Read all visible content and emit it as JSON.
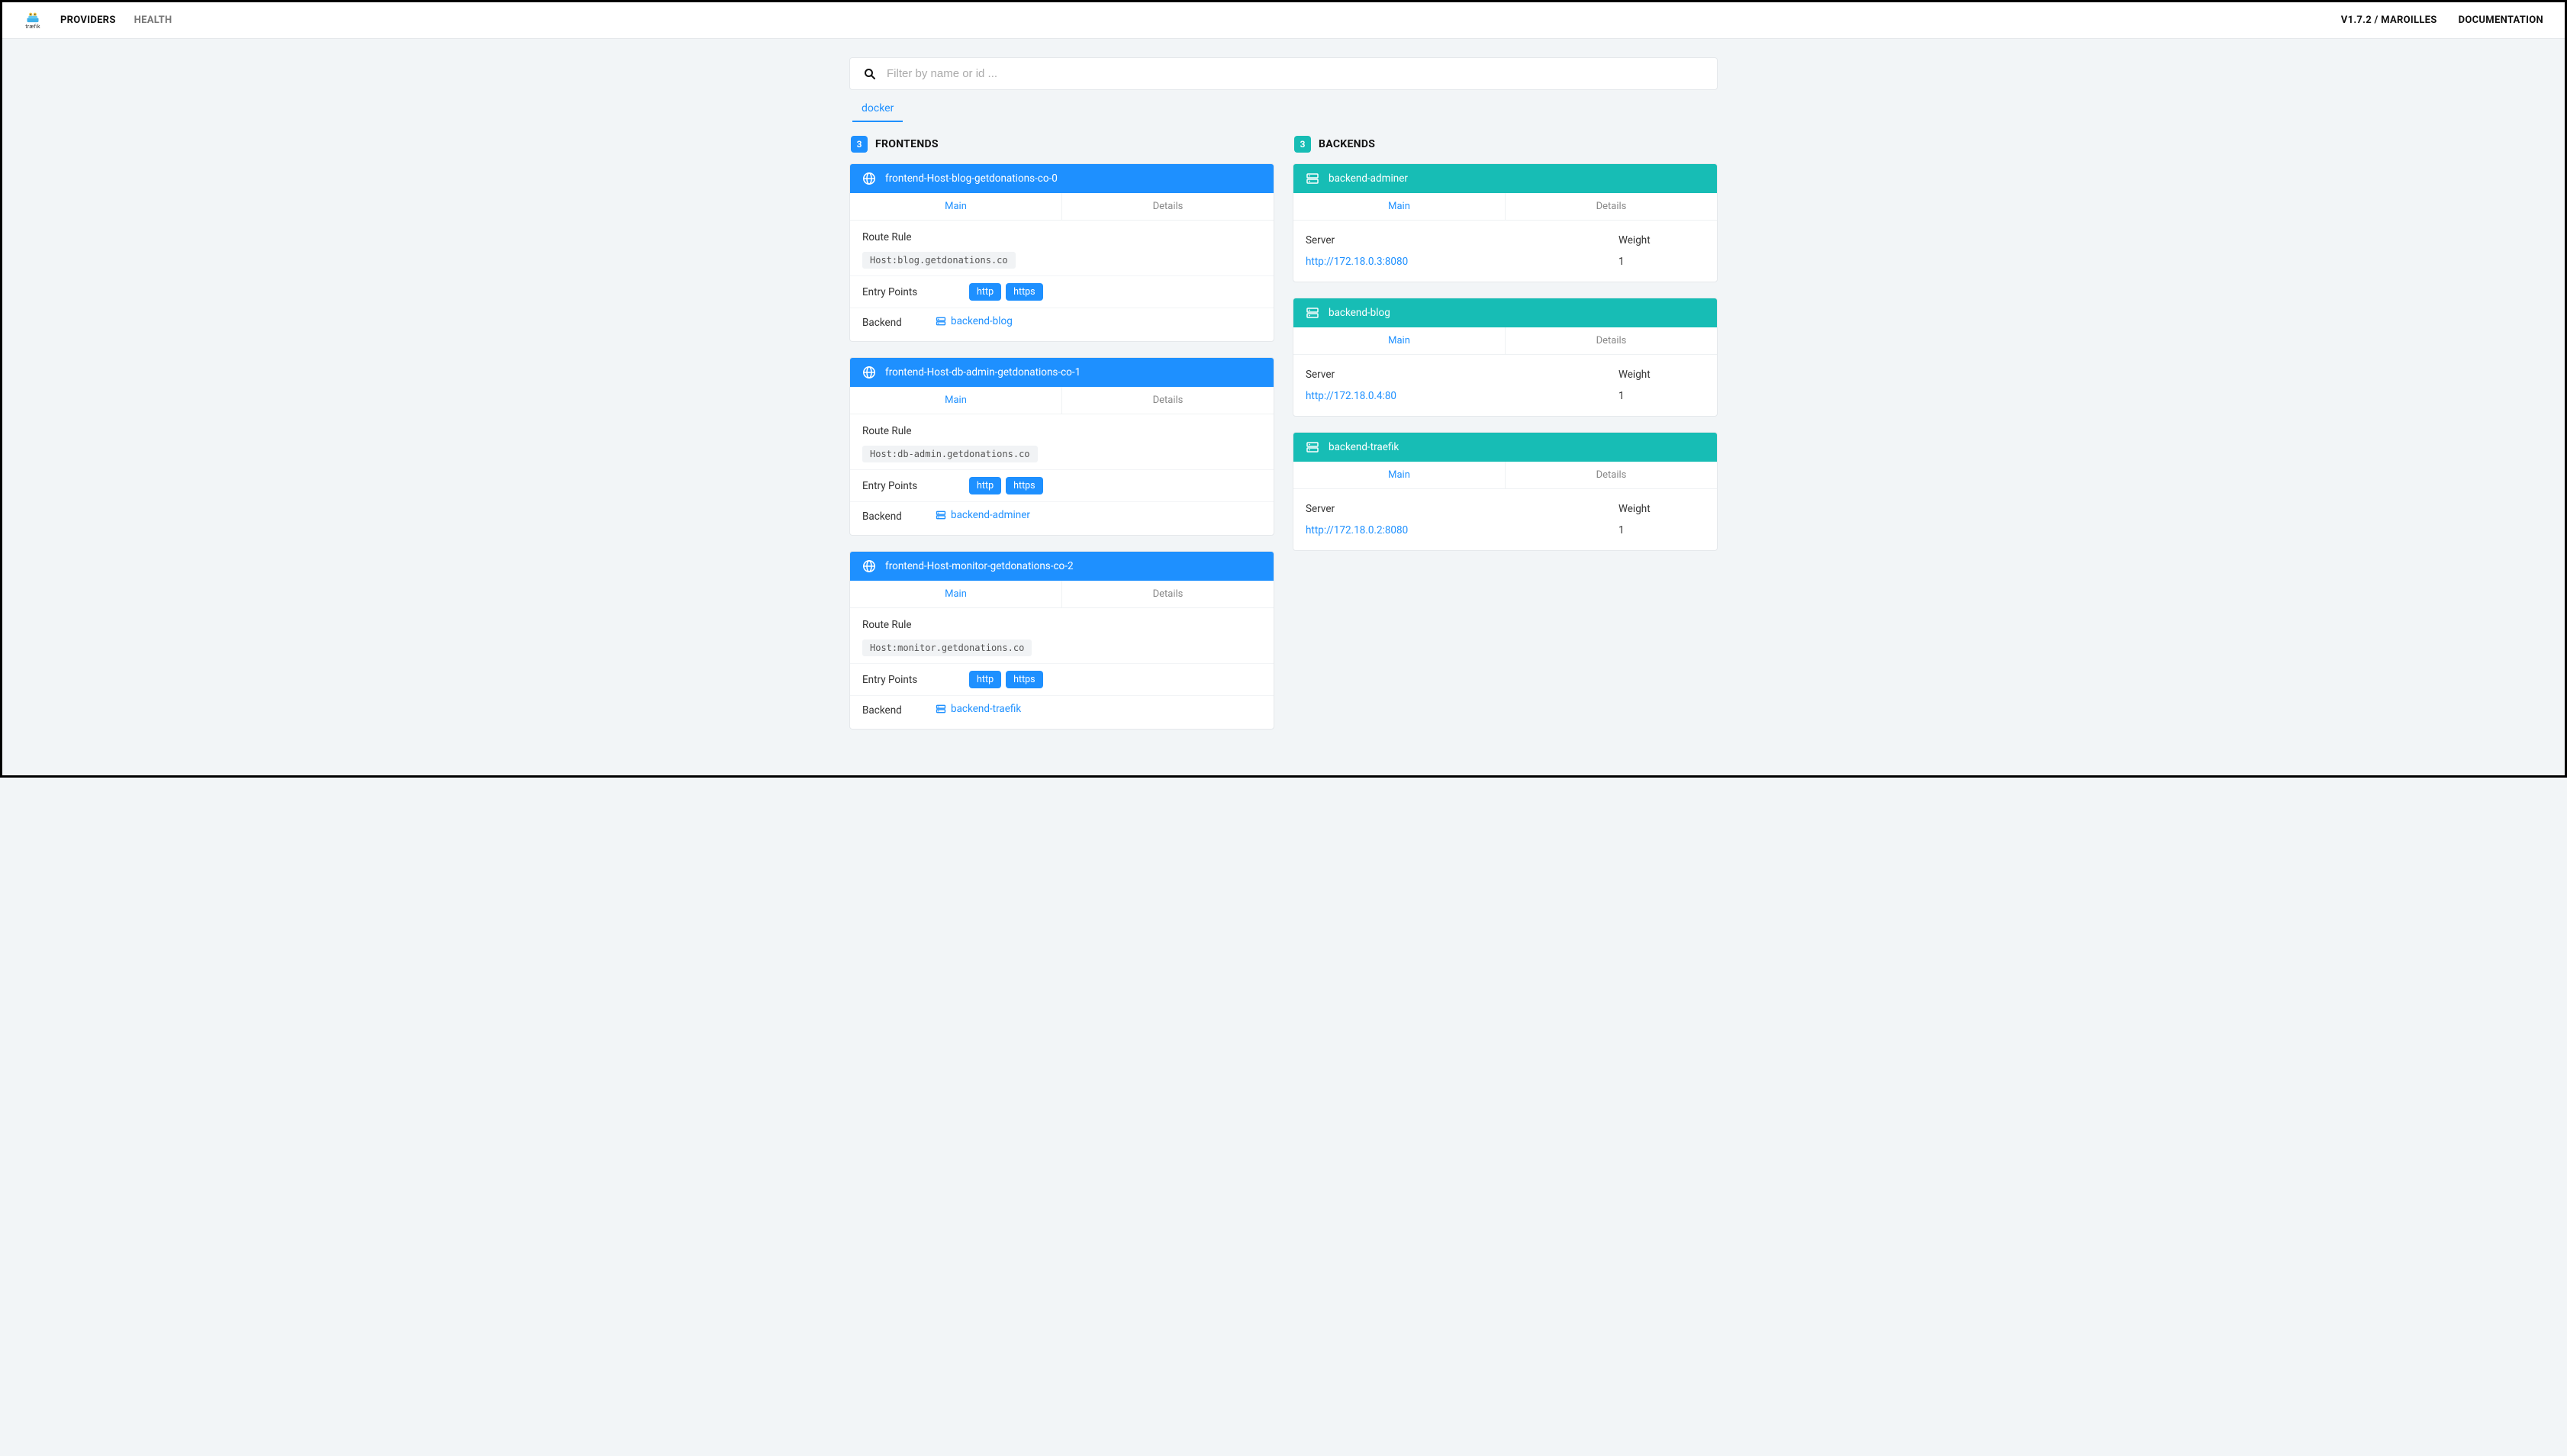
{
  "logo_text": "træfik",
  "nav": {
    "providers": "PROVIDERS",
    "health": "HEALTH",
    "version": "V1.7.2 / MAROILLES",
    "documentation": "DOCUMENTATION"
  },
  "search": {
    "placeholder": "Filter by name or id ..."
  },
  "provider_tab": "docker",
  "sections": {
    "frontends": {
      "count": "3",
      "title": "FRONTENDS"
    },
    "backends": {
      "count": "3",
      "title": "BACKENDS"
    }
  },
  "labels": {
    "main": "Main",
    "details": "Details",
    "route_rule": "Route Rule",
    "entry_points": "Entry Points",
    "backend": "Backend",
    "server": "Server",
    "weight": "Weight"
  },
  "frontends": [
    {
      "name": "frontend-Host-blog-getdonations-co-0",
      "rule": "Host:blog.getdonations.co",
      "entry_points": [
        "http",
        "https"
      ],
      "backend": "backend-blog"
    },
    {
      "name": "frontend-Host-db-admin-getdonations-co-1",
      "rule": "Host:db-admin.getdonations.co",
      "entry_points": [
        "http",
        "https"
      ],
      "backend": "backend-adminer"
    },
    {
      "name": "frontend-Host-monitor-getdonations-co-2",
      "rule": "Host:monitor.getdonations.co",
      "entry_points": [
        "http",
        "https"
      ],
      "backend": "backend-traefik"
    }
  ],
  "backends": [
    {
      "name": "backend-adminer",
      "server": "http://172.18.0.3:8080",
      "weight": "1"
    },
    {
      "name": "backend-blog",
      "server": "http://172.18.0.4:80",
      "weight": "1"
    },
    {
      "name": "backend-traefik",
      "server": "http://172.18.0.2:8080",
      "weight": "1"
    }
  ]
}
